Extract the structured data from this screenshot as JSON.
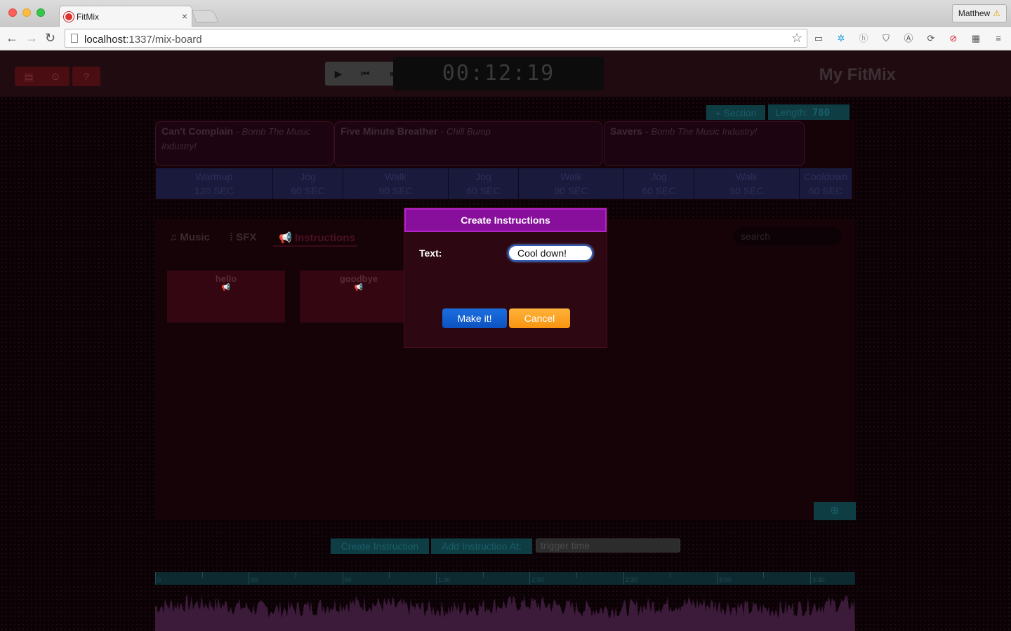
{
  "browser": {
    "tab_title": "FitMix",
    "tab_close": "×",
    "profile_name": "Matthew",
    "profile_warning": "⚠",
    "url_host": "localhost",
    "url_path": ":1337/mix-board",
    "back": "←",
    "forward": "→",
    "reload": "↻",
    "star": "☆"
  },
  "topbar": {
    "timer": "00:12:19",
    "brand": "My FitMix",
    "file_icon": "▤",
    "download_icon": "⊙",
    "help_icon": "?",
    "play": "▶",
    "skip_back": "⏮",
    "pause": "⏸"
  },
  "timeline": {
    "add_section_label": "+ Section",
    "length_label": "Length:",
    "length_value": "780",
    "songs": [
      {
        "title": "Can't Complain",
        "artist": "Bomb The Music Industry!"
      },
      {
        "title": "Five Minute Breather",
        "artist": "Chill Bump"
      },
      {
        "title": "Savers",
        "artist": "Bomb The Music Industry!"
      }
    ],
    "segments": [
      {
        "name": "Warmup",
        "duration": "120 SEC"
      },
      {
        "name": "Jog",
        "duration": "60 SEC"
      },
      {
        "name": "Walk",
        "duration": "90 SEC"
      },
      {
        "name": "Jog",
        "duration": "60 SEC"
      },
      {
        "name": "Walk",
        "duration": "90 SEC"
      },
      {
        "name": "Jog",
        "duration": "60 SEC"
      },
      {
        "name": "Walk",
        "duration": "90 SEC"
      },
      {
        "name": "Cooldown",
        "duration": "60 SEC"
      }
    ],
    "song_separator": " - "
  },
  "library": {
    "tabs": [
      {
        "label": "Music",
        "icon": "♫"
      },
      {
        "label": "SFX",
        "icon": "⁞"
      },
      {
        "label": "Instructions",
        "icon": "📢"
      }
    ],
    "search_placeholder": "search",
    "instructions": [
      {
        "name": "hello",
        "icon": "📢"
      },
      {
        "name": "goodbye",
        "icon": "📢"
      }
    ],
    "add_icon": "⊕"
  },
  "instruction_controls": {
    "create_label": "Create Instruction",
    "add_at_label": "Add Instruction At:",
    "trigger_placeholder": "trigger time"
  },
  "ruler": {
    "labels": [
      "0",
      "30",
      "60",
      "1:30",
      "2:00",
      "2:30",
      "3:00",
      "3:30"
    ]
  },
  "modal": {
    "title": "Create Instructions",
    "text_label": "Text:",
    "text_value": "Cool down!",
    "make_label": "Make it!",
    "cancel_label": "Cancel"
  }
}
